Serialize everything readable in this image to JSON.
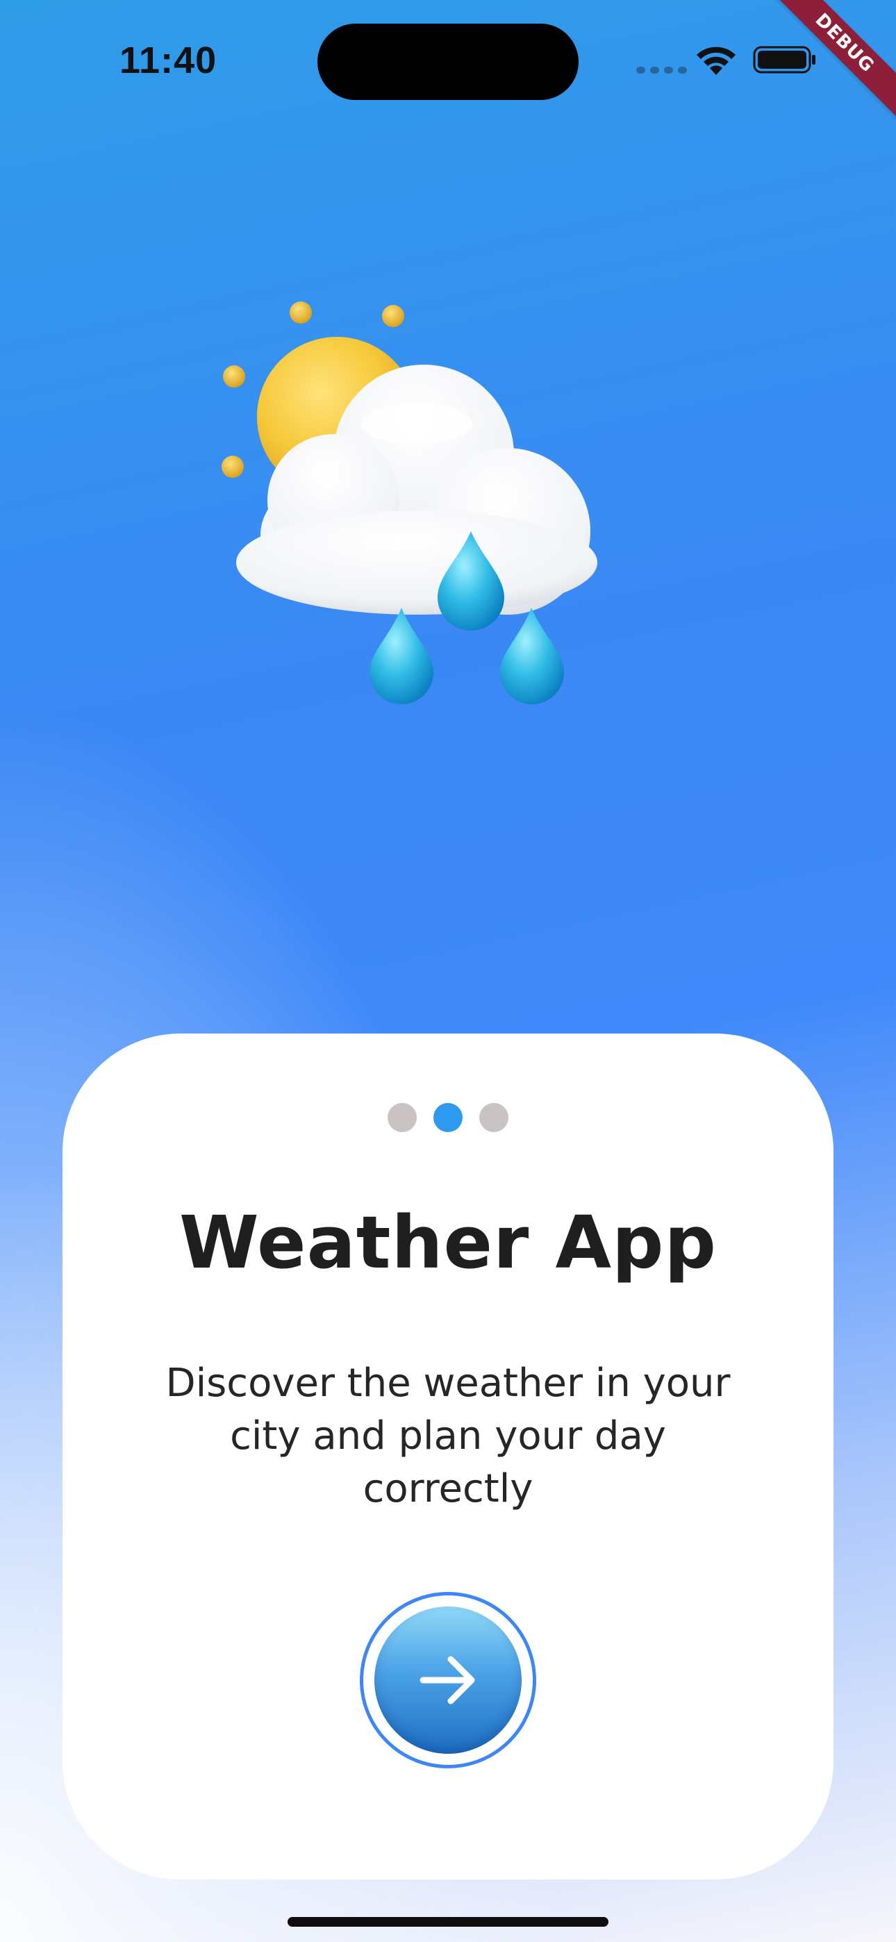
{
  "status_bar": {
    "time": "11:40"
  },
  "debug_banner": {
    "label": "DEBUG"
  },
  "hero": {
    "icon": "partly-cloudy-rain-icon"
  },
  "onboarding": {
    "page_count": 3,
    "active_page": 2,
    "title": "Weather App",
    "description": "Discover the weather in your city and plan your day correctly",
    "next_icon": "arrow-right-icon"
  },
  "colors": {
    "accent": "#2d9af0",
    "inactive_dot": "#c9c3c3",
    "button_ring": "#3d86f4",
    "debug_ribbon": "#8e1f3a"
  }
}
